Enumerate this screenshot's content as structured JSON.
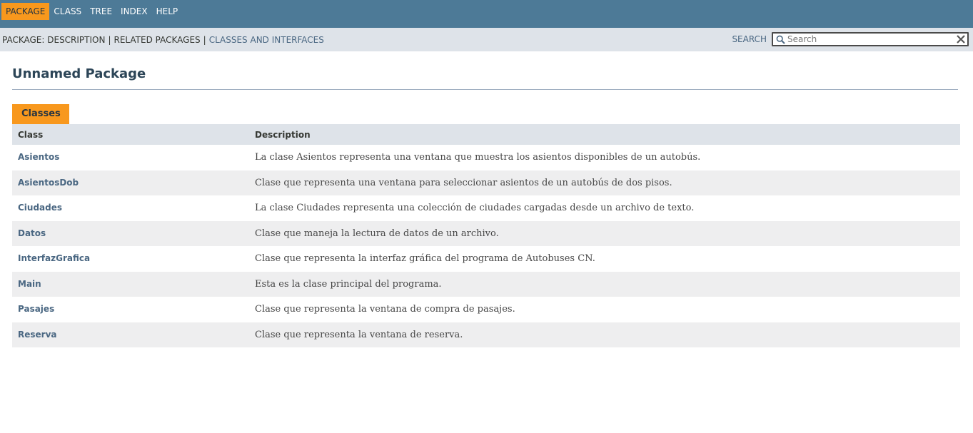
{
  "topnav": {
    "items": [
      {
        "label": "PACKAGE",
        "active": true
      },
      {
        "label": "CLASS",
        "active": false
      },
      {
        "label": "TREE",
        "active": false
      },
      {
        "label": "INDEX",
        "active": false
      },
      {
        "label": "HELP",
        "active": false
      }
    ]
  },
  "subnav": {
    "package_description": "PACKAGE: DESCRIPTION",
    "related_packages": "RELATED PACKAGES",
    "classes_and_interfaces": "CLASSES AND INTERFACES",
    "separator": "|",
    "search_label": "SEARCH",
    "search_placeholder": "Search",
    "search_value": ""
  },
  "page": {
    "title": "Unnamed Package"
  },
  "classes_table": {
    "caption": "Classes",
    "headers": [
      "Class",
      "Description"
    ],
    "rows": [
      {
        "name": "Asientos",
        "description": "La clase Asientos representa una ventana que muestra los asientos disponibles de un autobús."
      },
      {
        "name": "AsientosDob",
        "description": "Clase que representa una ventana para seleccionar asientos de un autobús de dos pisos."
      },
      {
        "name": "Ciudades",
        "description": "La clase Ciudades representa una colección de ciudades cargadas desde un archivo de texto."
      },
      {
        "name": "Datos",
        "description": "Clase que maneja la lectura de datos de un archivo."
      },
      {
        "name": "InterfazGrafica",
        "description": "Clase que representa la interfaz gráfica del programa de Autobuses CN."
      },
      {
        "name": "Main",
        "description": "Esta es la clase principal del programa."
      },
      {
        "name": "Pasajes",
        "description": "Clase que representa la ventana de compra de pasajes."
      },
      {
        "name": "Reserva",
        "description": "Clase que representa la ventana de reserva."
      }
    ]
  },
  "colors": {
    "topnav_bg": "#4d7a97",
    "active_tab": "#f8981d",
    "subnav_bg": "#dee3e9",
    "link": "#4a6782"
  },
  "icons": {
    "search": "magnifier-icon",
    "reset": "close-icon"
  }
}
